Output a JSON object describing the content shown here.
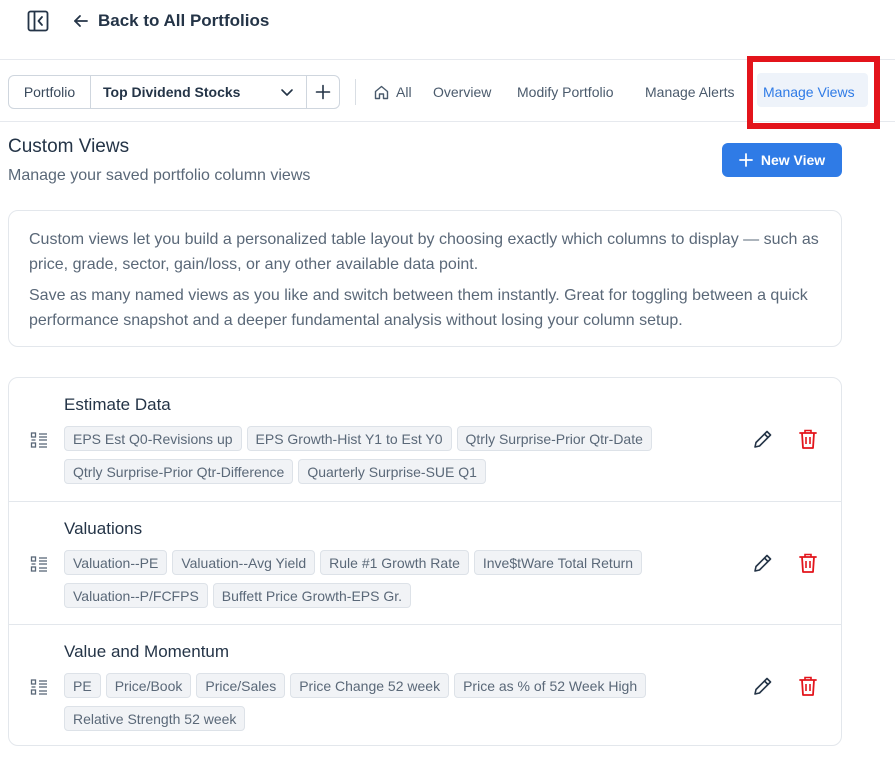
{
  "header": {
    "back_label": "Back to All Portfolios"
  },
  "toolbar": {
    "portfolio_label": "Portfolio",
    "portfolio_selected": "Top Dividend Stocks",
    "tabs": [
      {
        "label": "All",
        "icon": "home-icon"
      },
      {
        "label": "Overview"
      },
      {
        "label": "Modify Portfolio"
      },
      {
        "label": "Manage Alerts"
      },
      {
        "label": "Manage Views",
        "active": true
      }
    ]
  },
  "main": {
    "title": "Custom Views",
    "subtitle": "Manage your saved portfolio column views",
    "new_view_label": "New View",
    "info": [
      "Custom views let you build a personalized table layout by choosing exactly which columns to display — such as price, grade, sector, gain/loss, or any other available data point.",
      "Save as many named views as you like and switch between them instantly. Great for toggling between a quick performance snapshot and a deeper fundamental analysis without losing your column setup."
    ],
    "views": [
      {
        "name": "Estimate Data",
        "columns": [
          "EPS Est Q0-Revisions up",
          "EPS Growth-Hist Y1 to Est Y0",
          "Qtrly Surprise-Prior Qtr-Date",
          "Qtrly Surprise-Prior Qtr-Difference",
          "Quarterly Surprise-SUE Q1"
        ]
      },
      {
        "name": "Valuations",
        "columns": [
          "Valuation--PE",
          "Valuation--Avg Yield",
          "Rule #1 Growth Rate",
          "Inve$tWare Total Return",
          "Valuation--P/FCFPS",
          "Buffett Price Growth-EPS Gr."
        ]
      },
      {
        "name": "Value and Momentum",
        "columns": [
          "PE",
          "Price/Book",
          "Price/Sales",
          "Price Change 52 week",
          "Price as % of 52 Week High",
          "Relative Strength 52 week"
        ]
      }
    ]
  },
  "colors": {
    "accent": "#2f7be6",
    "delete": "#e3141b",
    "highlight": "#e3141b"
  }
}
